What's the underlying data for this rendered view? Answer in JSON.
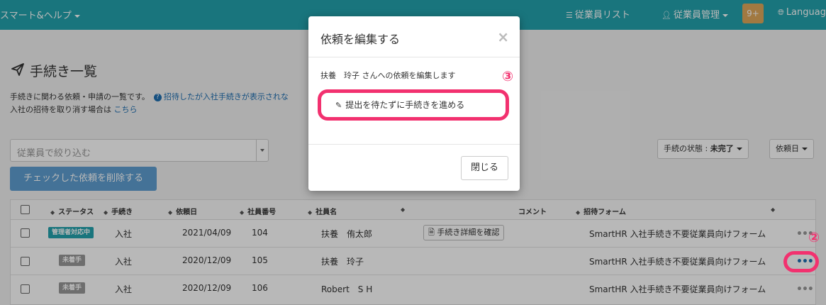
{
  "topnav": {
    "smart_help": "スマート&ヘルプ",
    "employee_list": "従業員リスト",
    "employee_mgmt": "従業員管理",
    "notif_count": "9+",
    "language": "Languag",
    "list_icon": "list-icon",
    "user_icon": "user-icon",
    "globe_icon": "globe-icon"
  },
  "page": {
    "title": "手続き一覧",
    "title_icon": "paper-plane-icon",
    "desc_line1": "手続きに関わる依頼・申請の一覧です。",
    "desc_link1": "招待したが入社手続きが表示されな",
    "desc_line2": "入社の招待を取り消す場合は",
    "desc_link2": "こちら"
  },
  "filter": {
    "placeholder": "従業員で絞り込む",
    "delete_button": "チェックした依頼を削除する",
    "status_label": "手続の状態 : ",
    "status_value": "未完了",
    "sort_label": "依頼日"
  },
  "table": {
    "headers": {
      "status": "ステータス",
      "procedure": "手続き",
      "request_date": "依頼日",
      "emp_no": "社員番号",
      "name": "社員名",
      "comment": "コメント",
      "form": "招待フォーム"
    },
    "rows": [
      {
        "status": "管理者対応中",
        "procedure": "入社",
        "date": "2021/04/09",
        "emp_no": "104",
        "name": "扶養　侑太郎",
        "action": "手続き詳細を確認",
        "form": "SmartHR 入社手続き不要従業員向けフォーム"
      },
      {
        "status": "未着手",
        "procedure": "入社",
        "date": "2020/12/09",
        "emp_no": "105",
        "name": "扶養　玲子",
        "action": "",
        "form": "SmartHR 入社手続き不要従業員向けフォーム"
      },
      {
        "status": "未着手",
        "procedure": "入社",
        "date": "2020/12/09",
        "emp_no": "106",
        "name": "Robert　S H",
        "action": "",
        "form": "SmartHR 入社手続き不要従業員向けフォーム"
      }
    ]
  },
  "modal": {
    "title": "依頼を編集する",
    "close_x": "×",
    "description": "扶養　玲子 さんへの依頼を編集します",
    "proceed_button": "提出を待たずに手続きを進める",
    "close_button": "閉じる"
  },
  "annotations": {
    "step2": "②",
    "step3": "③"
  },
  "colors": {
    "header": "#23a3ad",
    "accent": "#f2316f",
    "primary_button": "#5f9fd1",
    "link": "#1f6fb2"
  }
}
